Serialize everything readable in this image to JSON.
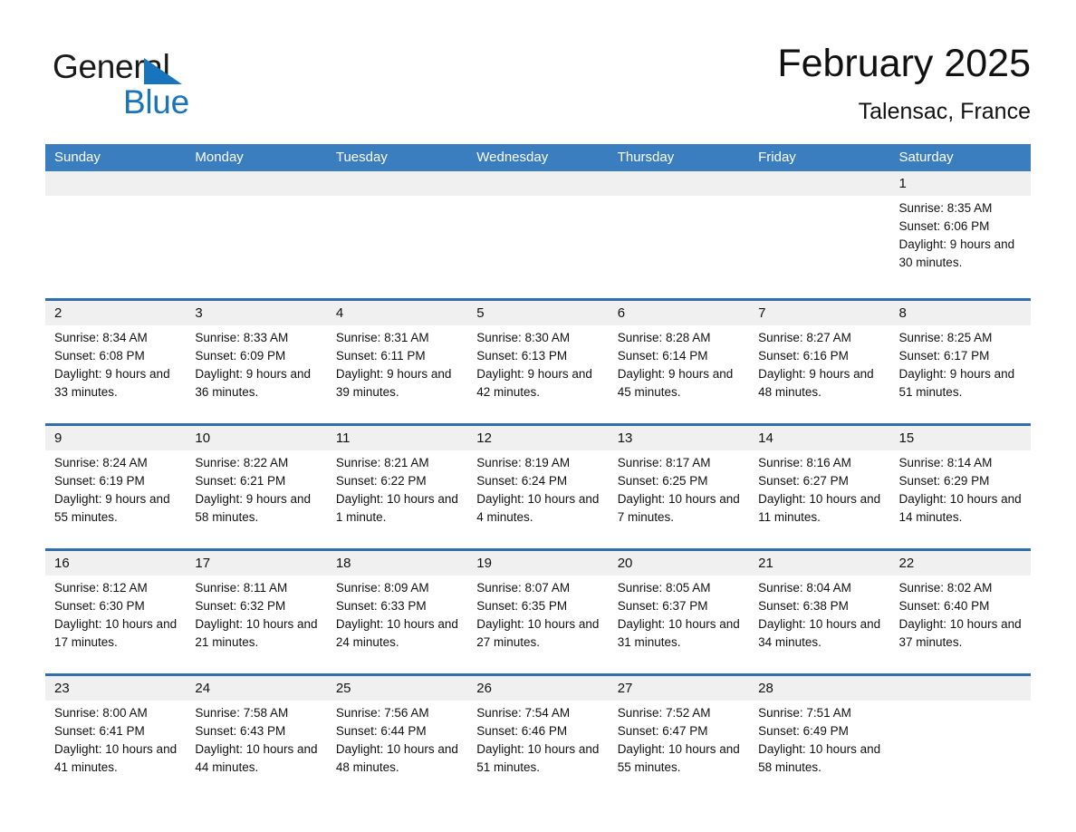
{
  "brand": {
    "name_part1": "General",
    "name_part2": "Blue",
    "triangle_color": "#1874bd",
    "logo_icon": "triangle-icon"
  },
  "header": {
    "title": "February 2025",
    "subtitle": "Talensac, France"
  },
  "colors": {
    "header_bar": "#3a7ebf",
    "week_rule": "#2f6fae",
    "daynum_band": "#f0f0f0",
    "text": "#111111"
  },
  "weekdays": [
    "Sunday",
    "Monday",
    "Tuesday",
    "Wednesday",
    "Thursday",
    "Friday",
    "Saturday"
  ],
  "weeks": [
    [
      {
        "day": "",
        "sunrise": "",
        "sunset": "",
        "daylight": "",
        "empty": true
      },
      {
        "day": "",
        "sunrise": "",
        "sunset": "",
        "daylight": "",
        "empty": true
      },
      {
        "day": "",
        "sunrise": "",
        "sunset": "",
        "daylight": "",
        "empty": true
      },
      {
        "day": "",
        "sunrise": "",
        "sunset": "",
        "daylight": "",
        "empty": true
      },
      {
        "day": "",
        "sunrise": "",
        "sunset": "",
        "daylight": "",
        "empty": true
      },
      {
        "day": "",
        "sunrise": "",
        "sunset": "",
        "daylight": "",
        "empty": true
      },
      {
        "day": "1",
        "sunrise": "Sunrise: 8:35 AM",
        "sunset": "Sunset: 6:06 PM",
        "daylight": "Daylight: 9 hours and 30 minutes.",
        "empty": false
      }
    ],
    [
      {
        "day": "2",
        "sunrise": "Sunrise: 8:34 AM",
        "sunset": "Sunset: 6:08 PM",
        "daylight": "Daylight: 9 hours and 33 minutes.",
        "empty": false
      },
      {
        "day": "3",
        "sunrise": "Sunrise: 8:33 AM",
        "sunset": "Sunset: 6:09 PM",
        "daylight": "Daylight: 9 hours and 36 minutes.",
        "empty": false
      },
      {
        "day": "4",
        "sunrise": "Sunrise: 8:31 AM",
        "sunset": "Sunset: 6:11 PM",
        "daylight": "Daylight: 9 hours and 39 minutes.",
        "empty": false
      },
      {
        "day": "5",
        "sunrise": "Sunrise: 8:30 AM",
        "sunset": "Sunset: 6:13 PM",
        "daylight": "Daylight: 9 hours and 42 minutes.",
        "empty": false
      },
      {
        "day": "6",
        "sunrise": "Sunrise: 8:28 AM",
        "sunset": "Sunset: 6:14 PM",
        "daylight": "Daylight: 9 hours and 45 minutes.",
        "empty": false
      },
      {
        "day": "7",
        "sunrise": "Sunrise: 8:27 AM",
        "sunset": "Sunset: 6:16 PM",
        "daylight": "Daylight: 9 hours and 48 minutes.",
        "empty": false
      },
      {
        "day": "8",
        "sunrise": "Sunrise: 8:25 AM",
        "sunset": "Sunset: 6:17 PM",
        "daylight": "Daylight: 9 hours and 51 minutes.",
        "empty": false
      }
    ],
    [
      {
        "day": "9",
        "sunrise": "Sunrise: 8:24 AM",
        "sunset": "Sunset: 6:19 PM",
        "daylight": "Daylight: 9 hours and 55 minutes.",
        "empty": false
      },
      {
        "day": "10",
        "sunrise": "Sunrise: 8:22 AM",
        "sunset": "Sunset: 6:21 PM",
        "daylight": "Daylight: 9 hours and 58 minutes.",
        "empty": false
      },
      {
        "day": "11",
        "sunrise": "Sunrise: 8:21 AM",
        "sunset": "Sunset: 6:22 PM",
        "daylight": "Daylight: 10 hours and 1 minute.",
        "empty": false
      },
      {
        "day": "12",
        "sunrise": "Sunrise: 8:19 AM",
        "sunset": "Sunset: 6:24 PM",
        "daylight": "Daylight: 10 hours and 4 minutes.",
        "empty": false
      },
      {
        "day": "13",
        "sunrise": "Sunrise: 8:17 AM",
        "sunset": "Sunset: 6:25 PM",
        "daylight": "Daylight: 10 hours and 7 minutes.",
        "empty": false
      },
      {
        "day": "14",
        "sunrise": "Sunrise: 8:16 AM",
        "sunset": "Sunset: 6:27 PM",
        "daylight": "Daylight: 10 hours and 11 minutes.",
        "empty": false
      },
      {
        "day": "15",
        "sunrise": "Sunrise: 8:14 AM",
        "sunset": "Sunset: 6:29 PM",
        "daylight": "Daylight: 10 hours and 14 minutes.",
        "empty": false
      }
    ],
    [
      {
        "day": "16",
        "sunrise": "Sunrise: 8:12 AM",
        "sunset": "Sunset: 6:30 PM",
        "daylight": "Daylight: 10 hours and 17 minutes.",
        "empty": false
      },
      {
        "day": "17",
        "sunrise": "Sunrise: 8:11 AM",
        "sunset": "Sunset: 6:32 PM",
        "daylight": "Daylight: 10 hours and 21 minutes.",
        "empty": false
      },
      {
        "day": "18",
        "sunrise": "Sunrise: 8:09 AM",
        "sunset": "Sunset: 6:33 PM",
        "daylight": "Daylight: 10 hours and 24 minutes.",
        "empty": false
      },
      {
        "day": "19",
        "sunrise": "Sunrise: 8:07 AM",
        "sunset": "Sunset: 6:35 PM",
        "daylight": "Daylight: 10 hours and 27 minutes.",
        "empty": false
      },
      {
        "day": "20",
        "sunrise": "Sunrise: 8:05 AM",
        "sunset": "Sunset: 6:37 PM",
        "daylight": "Daylight: 10 hours and 31 minutes.",
        "empty": false
      },
      {
        "day": "21",
        "sunrise": "Sunrise: 8:04 AM",
        "sunset": "Sunset: 6:38 PM",
        "daylight": "Daylight: 10 hours and 34 minutes.",
        "empty": false
      },
      {
        "day": "22",
        "sunrise": "Sunrise: 8:02 AM",
        "sunset": "Sunset: 6:40 PM",
        "daylight": "Daylight: 10 hours and 37 minutes.",
        "empty": false
      }
    ],
    [
      {
        "day": "23",
        "sunrise": "Sunrise: 8:00 AM",
        "sunset": "Sunset: 6:41 PM",
        "daylight": "Daylight: 10 hours and 41 minutes.",
        "empty": false
      },
      {
        "day": "24",
        "sunrise": "Sunrise: 7:58 AM",
        "sunset": "Sunset: 6:43 PM",
        "daylight": "Daylight: 10 hours and 44 minutes.",
        "empty": false
      },
      {
        "day": "25",
        "sunrise": "Sunrise: 7:56 AM",
        "sunset": "Sunset: 6:44 PM",
        "daylight": "Daylight: 10 hours and 48 minutes.",
        "empty": false
      },
      {
        "day": "26",
        "sunrise": "Sunrise: 7:54 AM",
        "sunset": "Sunset: 6:46 PM",
        "daylight": "Daylight: 10 hours and 51 minutes.",
        "empty": false
      },
      {
        "day": "27",
        "sunrise": "Sunrise: 7:52 AM",
        "sunset": "Sunset: 6:47 PM",
        "daylight": "Daylight: 10 hours and 55 minutes.",
        "empty": false
      },
      {
        "day": "28",
        "sunrise": "Sunrise: 7:51 AM",
        "sunset": "Sunset: 6:49 PM",
        "daylight": "Daylight: 10 hours and 58 minutes.",
        "empty": false
      },
      {
        "day": "",
        "sunrise": "",
        "sunset": "",
        "daylight": "",
        "empty": true
      }
    ]
  ]
}
